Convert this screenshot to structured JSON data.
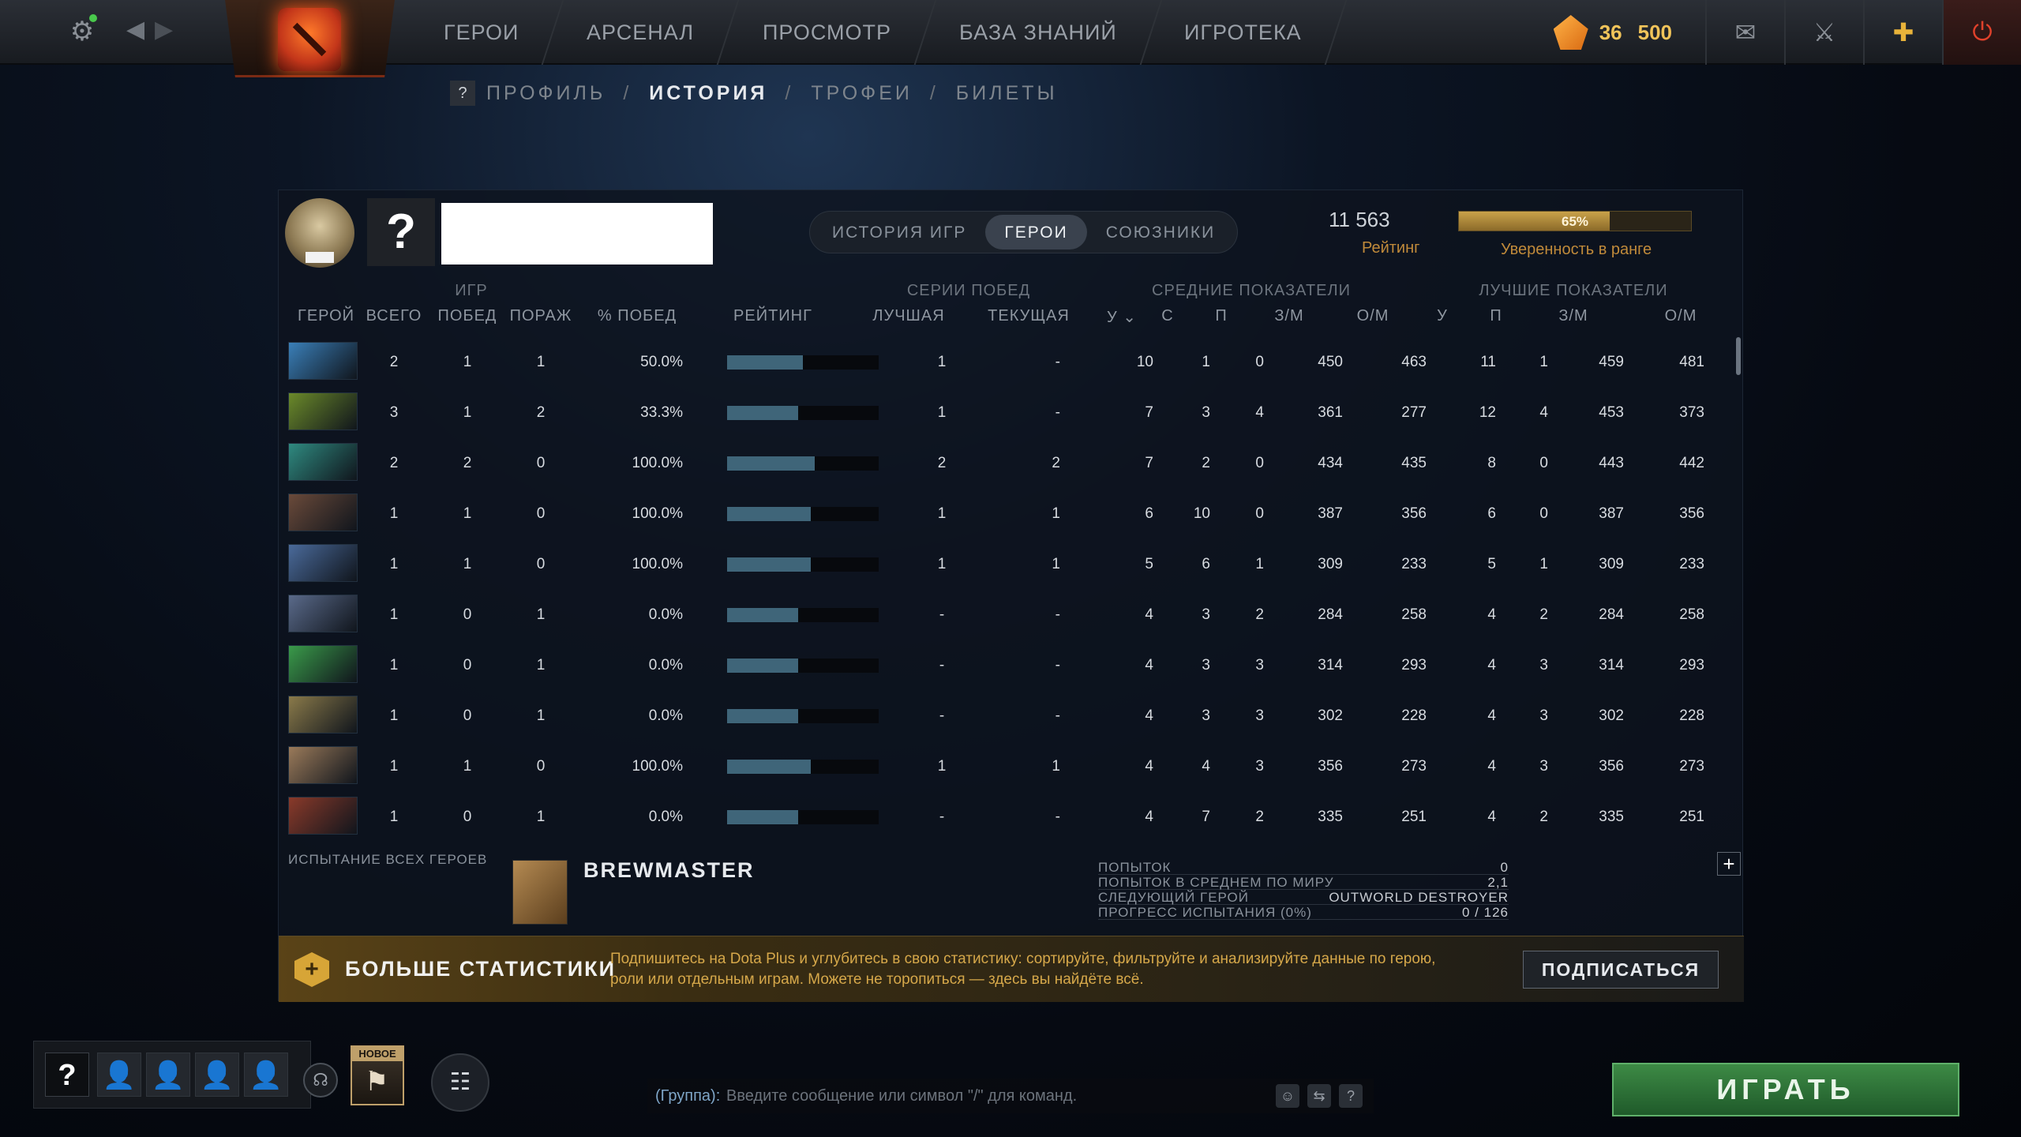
{
  "topbar": {
    "nav": [
      "ГЕРОИ",
      "АРСЕНАЛ",
      "ПРОСМОТР",
      "БАЗА ЗНАНИЙ",
      "ИГРОТЕКА"
    ],
    "shards_level": "36",
    "shards": "500",
    "icons": [
      "settings-icon",
      "back-icon",
      "forward-icon",
      "mail-icon",
      "armory-icon",
      "dota-plus-icon",
      "power-icon"
    ]
  },
  "subnav": {
    "help": "?",
    "items": [
      "ПРОФИЛЬ",
      "ИСТОРИЯ",
      "ТРОФЕИ",
      "БИЛЕТЫ"
    ],
    "active": "ИСТОРИЯ",
    "separator": "/"
  },
  "profile": {
    "avatar": "?",
    "tabs": [
      "ИСТОРИЯ ИГР",
      "ГЕРОИ",
      "СОЮЗНИКИ"
    ],
    "active_tab": "ГЕРОИ",
    "rating": "11 563",
    "rating_label": "Рейтинг",
    "confidence_pct": "65%",
    "confidence_value": 0.65,
    "confidence_label": "Уверенность в ранге"
  },
  "table": {
    "groups": {
      "games": "ИГР",
      "streaks": "СЕРИИ ПОБЕД",
      "avg": "СРЕДНИЕ ПОКАЗАТЕЛИ",
      "best": "ЛУЧШИЕ ПОКАЗАТЕЛИ"
    },
    "headers": {
      "hero": "ГЕРОЙ",
      "total": "ВСЕГО",
      "wins": "ПОБЕД",
      "losses": "ПОРАЖ",
      "winrate": "% ПОБЕД",
      "rating": "РЕЙТИНГ",
      "best_streak": "ЛУЧШАЯ",
      "cur_streak": "ТЕКУЩАЯ",
      "avg_k": "У",
      "avg_d": "С",
      "avg_a": "П",
      "avg_xpm": "З/М",
      "avg_gpm": "О/М",
      "best_k": "У",
      "best_a": "П",
      "best_xpm": "З/М",
      "best_gpm": "О/М"
    },
    "rows": [
      {
        "hero_color": "#3a7fb8",
        "total": "2",
        "wins": "1",
        "losses": "1",
        "winrate": "50.0%",
        "rating_fill": 0.5,
        "best_streak": "1",
        "cur_streak": "-",
        "avg_k": "10",
        "avg_d": "1",
        "avg_a": "0",
        "avg_xpm": "450",
        "avg_gpm": "463",
        "best_k": "11",
        "best_a": "1",
        "best_xpm": "459",
        "best_gpm": "481"
      },
      {
        "hero_color": "#6b8a2a",
        "total": "3",
        "wins": "1",
        "losses": "2",
        "winrate": "33.3%",
        "rating_fill": 0.47,
        "best_streak": "1",
        "cur_streak": "-",
        "avg_k": "7",
        "avg_d": "3",
        "avg_a": "4",
        "avg_xpm": "361",
        "avg_gpm": "277",
        "best_k": "12",
        "best_a": "4",
        "best_xpm": "453",
        "best_gpm": "373"
      },
      {
        "hero_color": "#2f8a80",
        "total": "2",
        "wins": "2",
        "losses": "0",
        "winrate": "100.0%",
        "rating_fill": 0.58,
        "best_streak": "2",
        "cur_streak": "2",
        "avg_k": "7",
        "avg_d": "2",
        "avg_a": "0",
        "avg_xpm": "434",
        "avg_gpm": "435",
        "best_k": "8",
        "best_a": "0",
        "best_xpm": "443",
        "best_gpm": "442"
      },
      {
        "hero_color": "#6a4a3a",
        "total": "1",
        "wins": "1",
        "losses": "0",
        "winrate": "100.0%",
        "rating_fill": 0.55,
        "best_streak": "1",
        "cur_streak": "1",
        "avg_k": "6",
        "avg_d": "10",
        "avg_a": "0",
        "avg_xpm": "387",
        "avg_gpm": "356",
        "best_k": "6",
        "best_a": "0",
        "best_xpm": "387",
        "best_gpm": "356"
      },
      {
        "hero_color": "#4a6a9a",
        "total": "1",
        "wins": "1",
        "losses": "0",
        "winrate": "100.0%",
        "rating_fill": 0.55,
        "best_streak": "1",
        "cur_streak": "1",
        "avg_k": "5",
        "avg_d": "6",
        "avg_a": "1",
        "avg_xpm": "309",
        "avg_gpm": "233",
        "best_k": "5",
        "best_a": "1",
        "best_xpm": "309",
        "best_gpm": "233"
      },
      {
        "hero_color": "#5a6a8a",
        "total": "1",
        "wins": "0",
        "losses": "1",
        "winrate": "0.0%",
        "rating_fill": 0.47,
        "best_streak": "-",
        "cur_streak": "-",
        "avg_k": "4",
        "avg_d": "3",
        "avg_a": "2",
        "avg_xpm": "284",
        "avg_gpm": "258",
        "best_k": "4",
        "best_a": "2",
        "best_xpm": "284",
        "best_gpm": "258"
      },
      {
        "hero_color": "#3a9a4a",
        "total": "1",
        "wins": "0",
        "losses": "1",
        "winrate": "0.0%",
        "rating_fill": 0.47,
        "best_streak": "-",
        "cur_streak": "-",
        "avg_k": "4",
        "avg_d": "3",
        "avg_a": "3",
        "avg_xpm": "314",
        "avg_gpm": "293",
        "best_k": "4",
        "best_a": "3",
        "best_xpm": "314",
        "best_gpm": "293"
      },
      {
        "hero_color": "#8a7a4a",
        "total": "1",
        "wins": "0",
        "losses": "1",
        "winrate": "0.0%",
        "rating_fill": 0.47,
        "best_streak": "-",
        "cur_streak": "-",
        "avg_k": "4",
        "avg_d": "3",
        "avg_a": "3",
        "avg_xpm": "302",
        "avg_gpm": "228",
        "best_k": "4",
        "best_a": "3",
        "best_xpm": "302",
        "best_gpm": "228"
      },
      {
        "hero_color": "#9a7a5a",
        "total": "1",
        "wins": "1",
        "losses": "0",
        "winrate": "100.0%",
        "rating_fill": 0.55,
        "best_streak": "1",
        "cur_streak": "1",
        "avg_k": "4",
        "avg_d": "4",
        "avg_a": "3",
        "avg_xpm": "356",
        "avg_gpm": "273",
        "best_k": "4",
        "best_a": "3",
        "best_xpm": "356",
        "best_gpm": "273"
      },
      {
        "hero_color": "#8a3a2a",
        "total": "1",
        "wins": "0",
        "losses": "1",
        "winrate": "0.0%",
        "rating_fill": 0.47,
        "best_streak": "-",
        "cur_streak": "-",
        "avg_k": "4",
        "avg_d": "7",
        "avg_a": "2",
        "avg_xpm": "335",
        "avg_gpm": "251",
        "best_k": "4",
        "best_a": "2",
        "best_xpm": "335",
        "best_gpm": "251"
      }
    ]
  },
  "challenge": {
    "title": "ИСПЫТАНИЕ ВСЕХ ГЕРОЕВ",
    "hero": "BREWMASTER",
    "stats": [
      {
        "label": "ПОПЫТОК",
        "value": "0"
      },
      {
        "label": "ПОПЫТОК В СРЕДНЕМ ПО МИРУ",
        "value": "2,1"
      },
      {
        "label": "СЛЕДУЮЩИЙ ГЕРОЙ",
        "value": "OUTWORLD DESTROYER"
      },
      {
        "label": "ПРОГРЕСС ИСПЫТАНИЯ (0%)",
        "value": "0 / 126"
      }
    ],
    "plus": "+"
  },
  "dota_plus": {
    "title": "БОЛЬШЕ СТАТИСТИКИ",
    "text": "Подпишитесь на Dota Plus и углубитесь в свою статистику: сортируйте, фильтруйте и анализируйте данные по герою, роли или отдельным играм. Можете не торопиться — здесь вы найдёте всё.",
    "button": "ПОДПИСАТЬСЯ"
  },
  "bottom": {
    "party_help": "?",
    "new_badge": "НОВОЕ",
    "chat_prefix": "(Группа):",
    "chat_placeholder": "Введите сообщение или символ \"/\" для команд.",
    "chat_help": "?",
    "play": "ИГРАТЬ"
  }
}
